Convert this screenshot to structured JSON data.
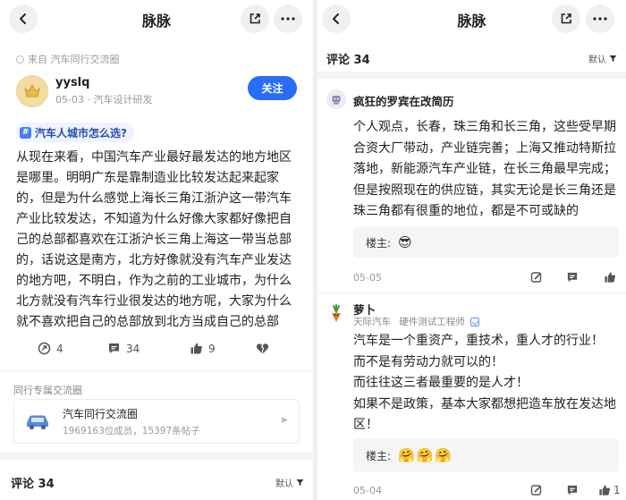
{
  "left": {
    "title": "脉脉",
    "source": "来自 汽车同行交流圈",
    "author": {
      "name": "yyslq",
      "meta": "05-03 · 汽车设计研发"
    },
    "follow_label": "关注",
    "topic": "汽车人城市怎么选?",
    "body": "从现在来看，中国汽车产业最好最发达的地方地区是哪里。明明广东是靠制造业比较发达起来起家的，但是为什么感觉上海长三角江浙沪这一带汽车产业比较发达，不知道为什么好像大家都好像把自己的总部都喜欢在江浙沪长三角上海这一带当总部的，话说这是南方，北方好像就没有汽车产业发达的地方吧，不明白，作为之前的工业城市，为什么北方就没有汽车行业很发达的地方呢，大家为什么就不喜欢把自己的总部放到北方当成自己的总部",
    "actions": {
      "share": "4",
      "comments": "34",
      "likes": "9",
      "dislike": ""
    },
    "group_section": "同行专属交流圈",
    "group": {
      "name": "汽车同行交流圈",
      "stats": "1969163位成员，15397条帖子"
    },
    "comments_title": "评论 34",
    "sort_label": "默认"
  },
  "right": {
    "title": "脉脉",
    "comments_title": "评论 34",
    "sort_label": "默认",
    "comments": [
      {
        "name": "疯狂的罗宾在改简历",
        "text": "个人观点，长春，珠三角和长三角，这些受早期合资大厂带动，产业链完善；上海又推动特斯拉落地，新能源汽车产业链，在长三角最早完成；但是按照现在的供应链，其实无论是长三角还是珠三角都有很重的地位，都是不可或缺的",
        "reply_label": "楼主:",
        "reply_emoji": "😎",
        "date": "05-05"
      },
      {
        "name": "萝卜",
        "company": "天际汽车",
        "role": "硬件测试工程师",
        "lines": [
          "汽车是一个重资产，重技术，重人才的行业！",
          "而不是有劳动力就可以的！",
          "而往往这三者最重要的是人才！",
          "如果不是政策，基本大家都想把造车放在发达地区！"
        ],
        "reply_label": "楼主:",
        "reply_emoji": "🤗🤗🤗",
        "date": "05-04",
        "likes": "1"
      }
    ]
  },
  "colors": {
    "accent": "#2a6cf6",
    "topic_bg": "#eef3ff",
    "reply_bg": "#f5f5f7"
  }
}
